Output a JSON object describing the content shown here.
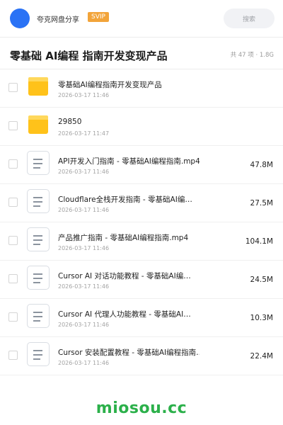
{
  "header": {
    "site_name": "夸克网盘分享",
    "badge": "SVIP",
    "search_placeholder": "搜索"
  },
  "title_bar": {
    "title": "零基础 AI编程 指南开发变现产品",
    "summary": "共 47 项 · 1.8G"
  },
  "files": [
    {
      "type": "folder",
      "name": "零基础AI编程指南开发变现产品",
      "date": "2026-03-17 11:46",
      "size": ""
    },
    {
      "type": "folder",
      "name": "29850",
      "date": "2026-03-17 11:47",
      "size": ""
    },
    {
      "type": "file",
      "name": "API开发入门指南 - 零基础AI编程指南.mp4",
      "date": "2026-03-17 11:46",
      "size": "47.8M"
    },
    {
      "type": "file",
      "name": "Cloudflare全栈开发指南 - 零基础AI编…",
      "date": "2026-03-17 11:46",
      "size": "27.5M"
    },
    {
      "type": "file",
      "name": "产品推广指南 - 零基础AI编程指南.mp4",
      "date": "2026-03-17 11:46",
      "size": "104.1M"
    },
    {
      "type": "file",
      "name": "Cursor AI 对话功能教程 - 零基础AI编…",
      "date": "2026-03-17 11:46",
      "size": "24.5M"
    },
    {
      "type": "file",
      "name": "Cursor AI 代理人功能教程 - 零基础AI…",
      "date": "2026-03-17 11:46",
      "size": "10.3M"
    },
    {
      "type": "file",
      "name": "Cursor 安装配置教程 - 零基础AI编程指南…",
      "date": "2026-03-17 11:46",
      "size": "22.4M"
    }
  ],
  "footer": {
    "watermark": "miosou.cc"
  },
  "colors": {
    "avatar": "#2a72f5",
    "badge": "#f2a43a",
    "folder": "#ffc21a",
    "watermark": "#2bb04a"
  },
  "icons": {
    "folder": "folder-icon",
    "file": "file-doc-icon"
  }
}
